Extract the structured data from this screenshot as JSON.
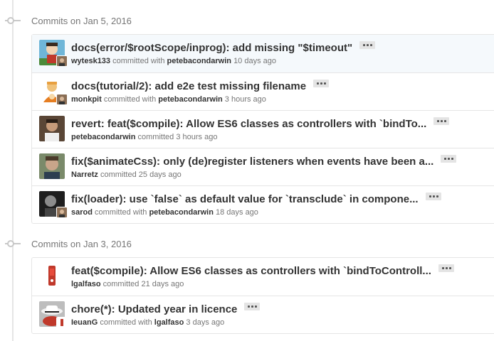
{
  "groups": [
    {
      "title": "Commits on Jan 5, 2016",
      "commits": [
        {
          "message": "docs(error/$rootScope/inprog): add missing \"$timeout\"",
          "author": "wytesk133",
          "verb": "committed with",
          "committer": "petebacondarwin",
          "time": "10 days ago"
        },
        {
          "message": "docs(tutorial/2): add e2e test missing filename",
          "author": "monkpit",
          "verb": "committed with",
          "committer": "petebacondarwin",
          "time": "3 hours ago"
        },
        {
          "message": "revert: feat($compile): Allow ES6 classes as controllers with `bindTo...",
          "author": "petebacondarwin",
          "verb": "committed",
          "committer": "",
          "time": "3 hours ago"
        },
        {
          "message": "fix($animateCss): only (de)register listeners when events have been a...",
          "author": "Narretz",
          "verb": "committed",
          "committer": "",
          "time": "25 days ago"
        },
        {
          "message": "fix(loader): use `false` as default value for `transclude` in compone...",
          "author": "sarod",
          "verb": "committed with",
          "committer": "petebacondarwin",
          "time": "18 days ago"
        }
      ]
    },
    {
      "title": "Commits on Jan 3, 2016",
      "commits": [
        {
          "message": "feat($compile): Allow ES6 classes as controllers with `bindToControll...",
          "author": "lgalfaso",
          "verb": "committed",
          "committer": "",
          "time": "21 days ago"
        },
        {
          "message": "chore(*): Updated year in licence",
          "author": "IeuanG",
          "verb": "committed with",
          "committer": "lgalfaso",
          "time": "3 days ago"
        }
      ]
    }
  ]
}
